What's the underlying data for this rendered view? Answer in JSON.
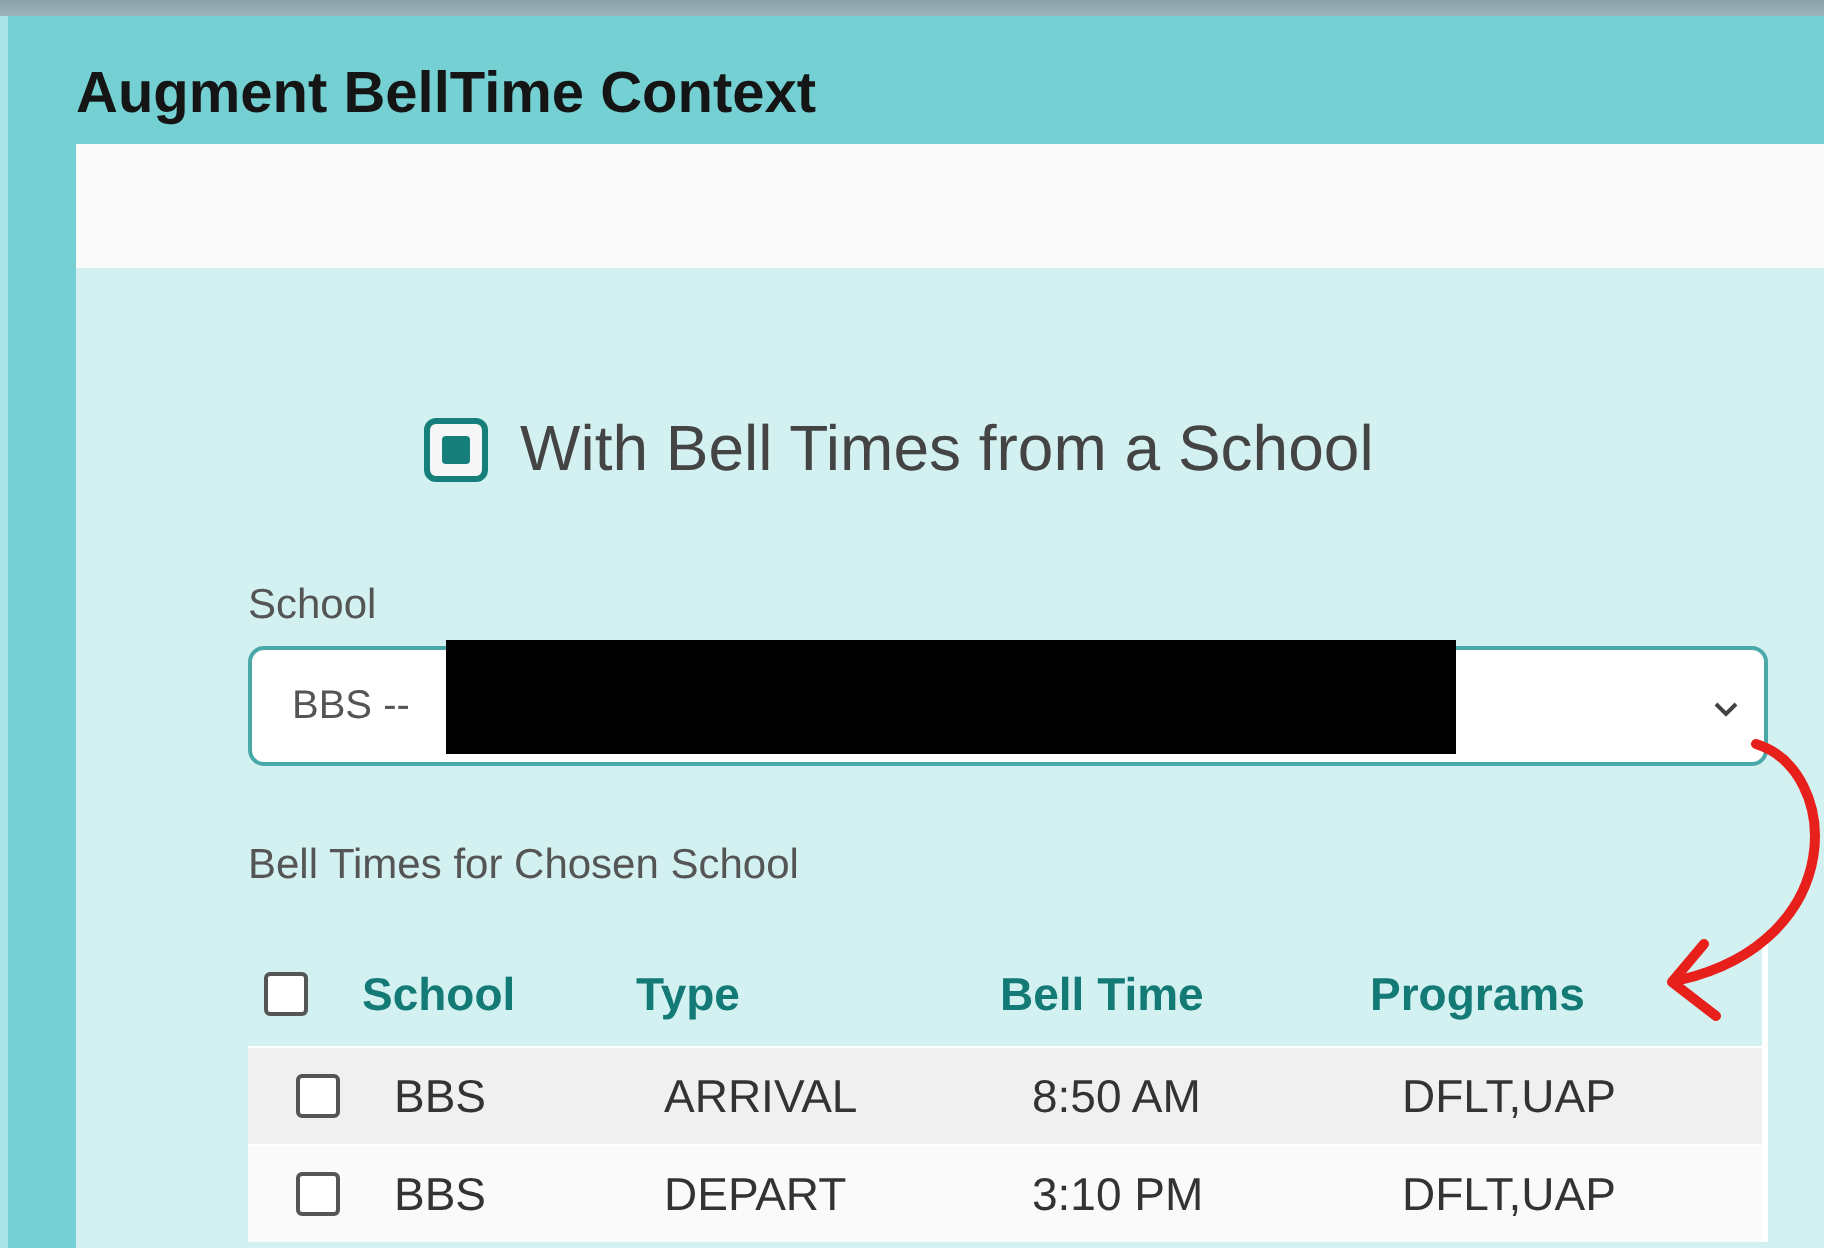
{
  "window": {
    "title": "Augment BellTime Context"
  },
  "option": {
    "label": "With Bell Times from a School",
    "checked": true
  },
  "school_field": {
    "label": "School",
    "value": "BBS --",
    "redacted": true
  },
  "table": {
    "caption": "Bell Times for Chosen School",
    "select_all_checked": false,
    "columns": [
      "School",
      "Type",
      "Bell Time",
      "Programs"
    ],
    "rows": [
      {
        "checked": false,
        "cells": [
          "BBS",
          "ARRIVAL",
          "8:50 AM",
          "DFLT,UAP"
        ]
      },
      {
        "checked": false,
        "cells": [
          "BBS",
          "DEPART",
          "3:10 PM",
          "DFLT,UAP"
        ]
      }
    ]
  },
  "annotation": {
    "kind": "arrow"
  }
}
